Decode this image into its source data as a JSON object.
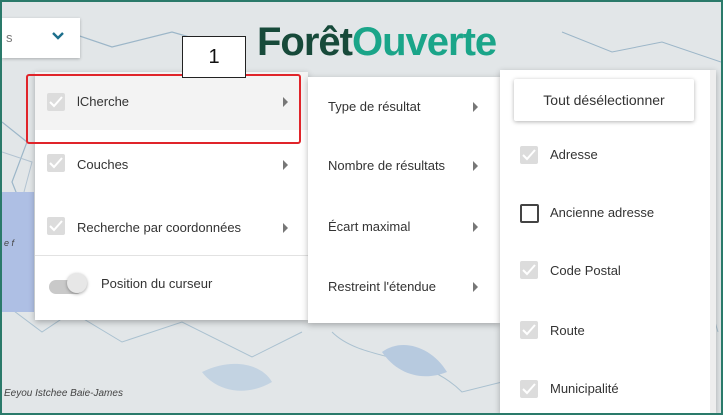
{
  "callout_number": "1",
  "logo": {
    "part1": "Forêt",
    "part2": "Ouverte"
  },
  "search": {
    "fragment": "s"
  },
  "map_labels": [
    "Eeyou Istchee Baie-James",
    "e f"
  ],
  "menu1": {
    "items": [
      {
        "label": "lCherche",
        "checked": true,
        "submenu": true
      },
      {
        "label": "Couches",
        "checked": true,
        "submenu": true
      },
      {
        "label": "Recherche par coordonnées",
        "checked": true,
        "submenu": true
      }
    ],
    "toggle_label": "Position du curseur",
    "toggle_on": false
  },
  "menu2": {
    "items": [
      {
        "label": "Type de résultat"
      },
      {
        "label": "Nombre de résultats"
      },
      {
        "label": "Écart maximal"
      },
      {
        "label": "Restreint l'étendue"
      }
    ]
  },
  "menu3": {
    "deselect_label": "Tout désélectionner",
    "items": [
      {
        "label": "Adresse",
        "checked": true
      },
      {
        "label": "Ancienne adresse",
        "checked": false
      },
      {
        "label": "Code Postal",
        "checked": true
      },
      {
        "label": "Route",
        "checked": true
      },
      {
        "label": "Municipalité",
        "checked": true
      }
    ]
  },
  "colors": {
    "highlight_border": "#e0242a",
    "brand_dark": "#174a3a",
    "brand_accent": "#1aa589"
  }
}
